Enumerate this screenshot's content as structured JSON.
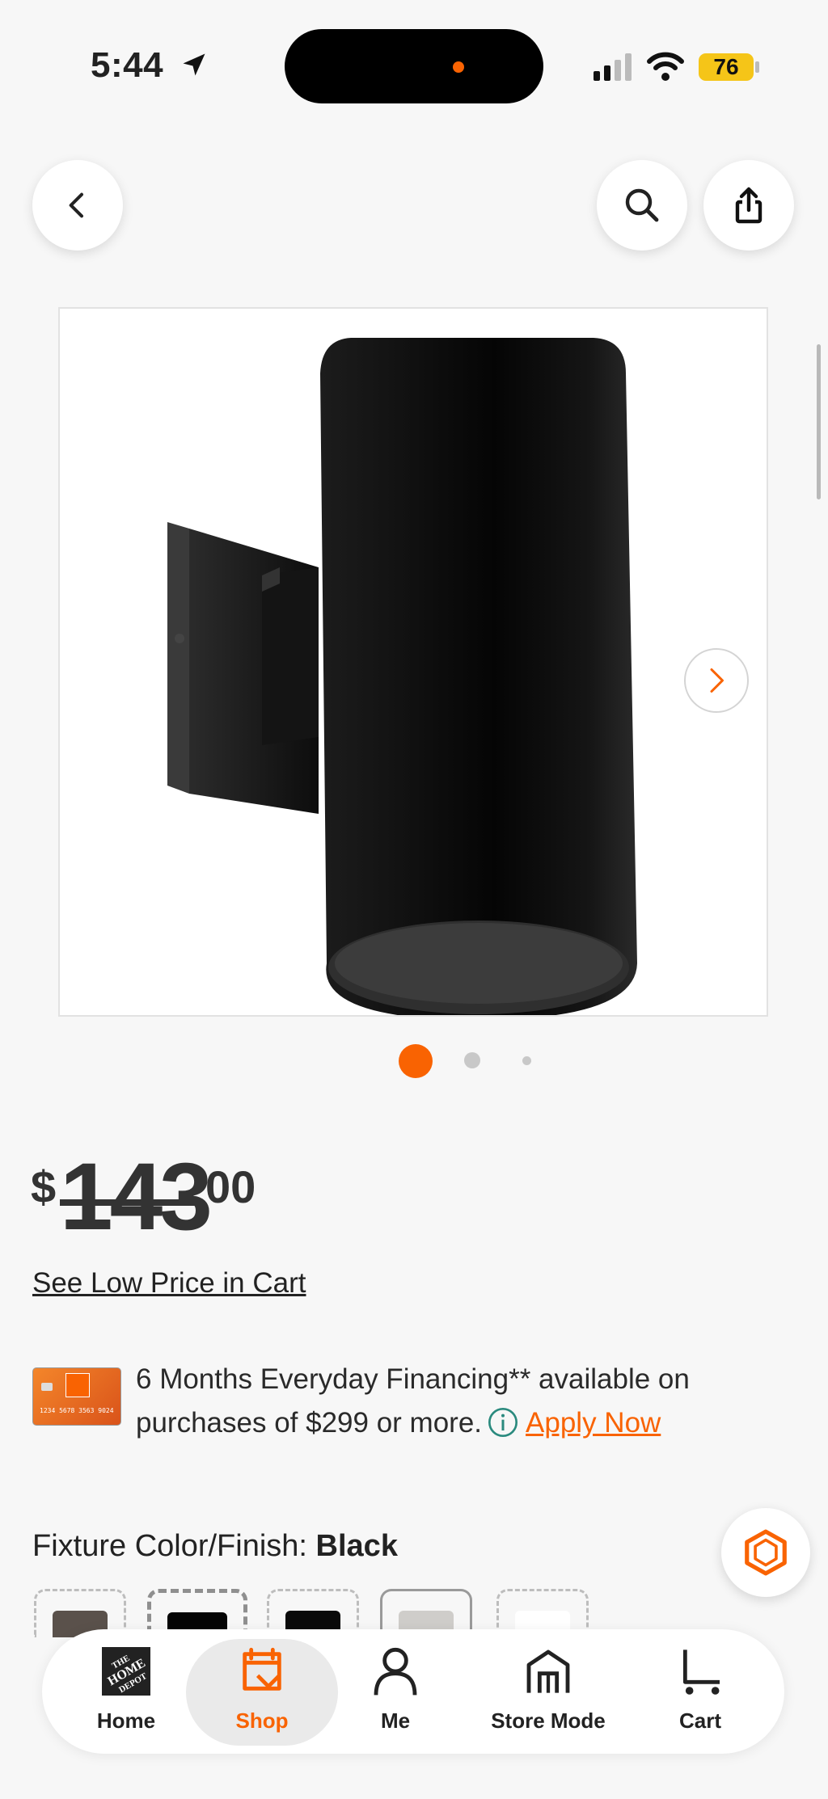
{
  "status_bar": {
    "time": "5:44",
    "battery": "76"
  },
  "product": {
    "currency": "$",
    "price_dollars": "143",
    "price_cents": "00",
    "see_low_price": "See Low Price in Cart",
    "image_count": 3,
    "active_image": 1
  },
  "financing": {
    "text_part1": "6 Months Everyday Financing** available on purchases of $299 or more.",
    "apply_label": "Apply Now",
    "card_number": "1234 5678 3563 9024"
  },
  "fixture": {
    "label": "Fixture Color/Finish: ",
    "value": "Black",
    "swatch_colors": [
      "#5a514b",
      "#050505",
      "#0a0a0a",
      "#cfcdca",
      "#ffffff"
    ]
  },
  "tabs": [
    {
      "label": "Home",
      "icon": "home-depot-logo-icon"
    },
    {
      "label": "Shop",
      "icon": "shop-icon"
    },
    {
      "label": "Me",
      "icon": "person-icon"
    },
    {
      "label": "Store Mode",
      "icon": "store-icon"
    },
    {
      "label": "Cart",
      "icon": "cart-icon"
    }
  ],
  "colors": {
    "accent": "#f96302",
    "text": "#222222"
  }
}
